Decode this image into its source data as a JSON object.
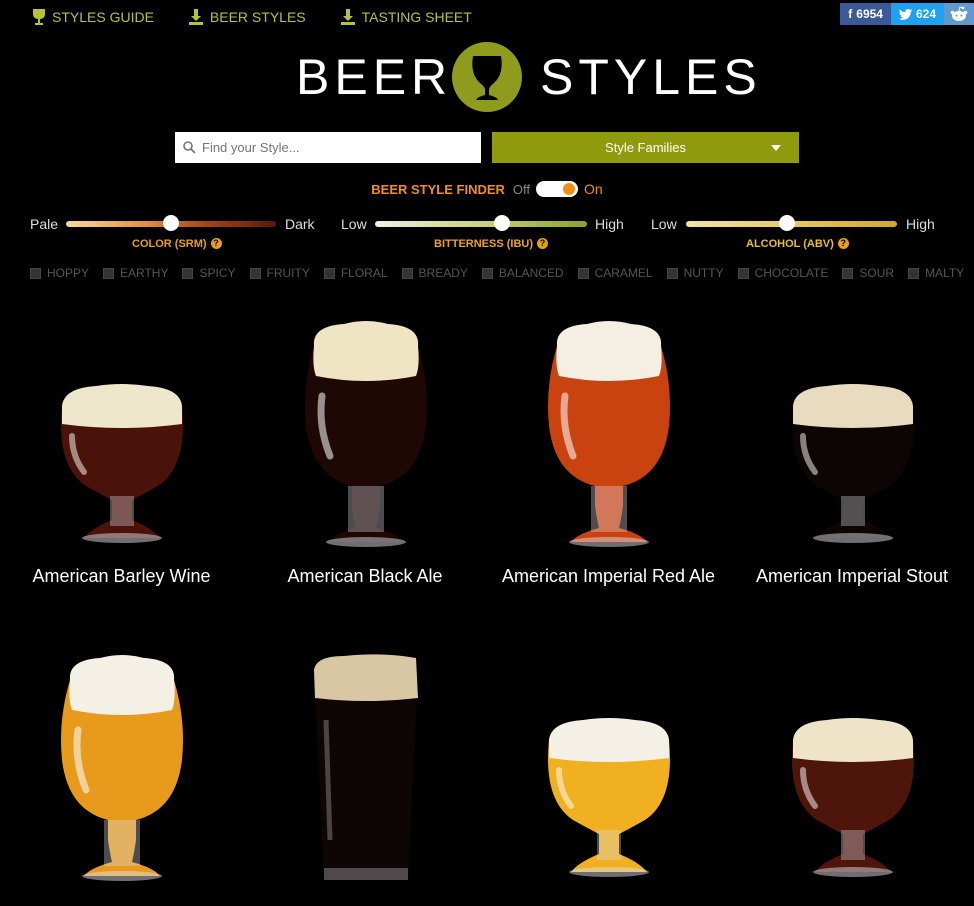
{
  "nav": [
    {
      "label": "STYLES GUIDE",
      "icon": "glass-icon"
    },
    {
      "label": "BEER STYLES",
      "icon": "download-icon"
    },
    {
      "label": "TASTING SHEET",
      "icon": "download-icon"
    }
  ],
  "social": {
    "facebook": "6954",
    "twitter": "624"
  },
  "logo": {
    "word1": "BEER",
    "word2": "STYLES"
  },
  "search": {
    "placeholder": "Find your Style..."
  },
  "families": {
    "label": "Style Families"
  },
  "finder": {
    "label": "BEER STYLE FINDER",
    "off": "Off",
    "on": "On"
  },
  "sliders": [
    {
      "low": "Pale",
      "high": "Dark",
      "caption": "COLOR (SRM)",
      "value": 0.5
    },
    {
      "low": "Low",
      "high": "High",
      "caption": "BITTERNESS (IBU)",
      "value": 0.6
    },
    {
      "low": "Low",
      "high": "High",
      "caption": "ALCOHOL (ABV)",
      "value": 0.48
    }
  ],
  "flavors": [
    "HOPPY",
    "EARTHY",
    "SPICY",
    "FRUITY",
    "FLORAL",
    "BREADY",
    "BALANCED",
    "CARAMEL",
    "NUTTY",
    "CHOCOLATE",
    "SOUR",
    "MALTY"
  ],
  "beers": [
    {
      "name": "American Barley Wine",
      "color": "#4a1208",
      "foam": "#efe7cc",
      "glass": "snifter"
    },
    {
      "name": "American Black Ale",
      "color": "#1e0805",
      "foam": "#efe4c4",
      "glass": "tulip"
    },
    {
      "name": "American Imperial Red Ale",
      "color": "#c9420f",
      "foam": "#f4efe2",
      "glass": "tulip"
    },
    {
      "name": "American Imperial Stout",
      "color": "#0c0504",
      "foam": "#e8dbc0",
      "glass": "snifter"
    },
    {
      "name": "",
      "color": "#e79a1c",
      "foam": "#f4f0e6",
      "glass": "tulip"
    },
    {
      "name": "",
      "color": "#0e0604",
      "foam": "#d9c7a3",
      "glass": "pint"
    },
    {
      "name": "",
      "color": "#f0b020",
      "foam": "#f4f0e6",
      "glass": "snifter"
    },
    {
      "name": "",
      "color": "#4e150a",
      "foam": "#efe4c8",
      "glass": "snifter"
    }
  ]
}
